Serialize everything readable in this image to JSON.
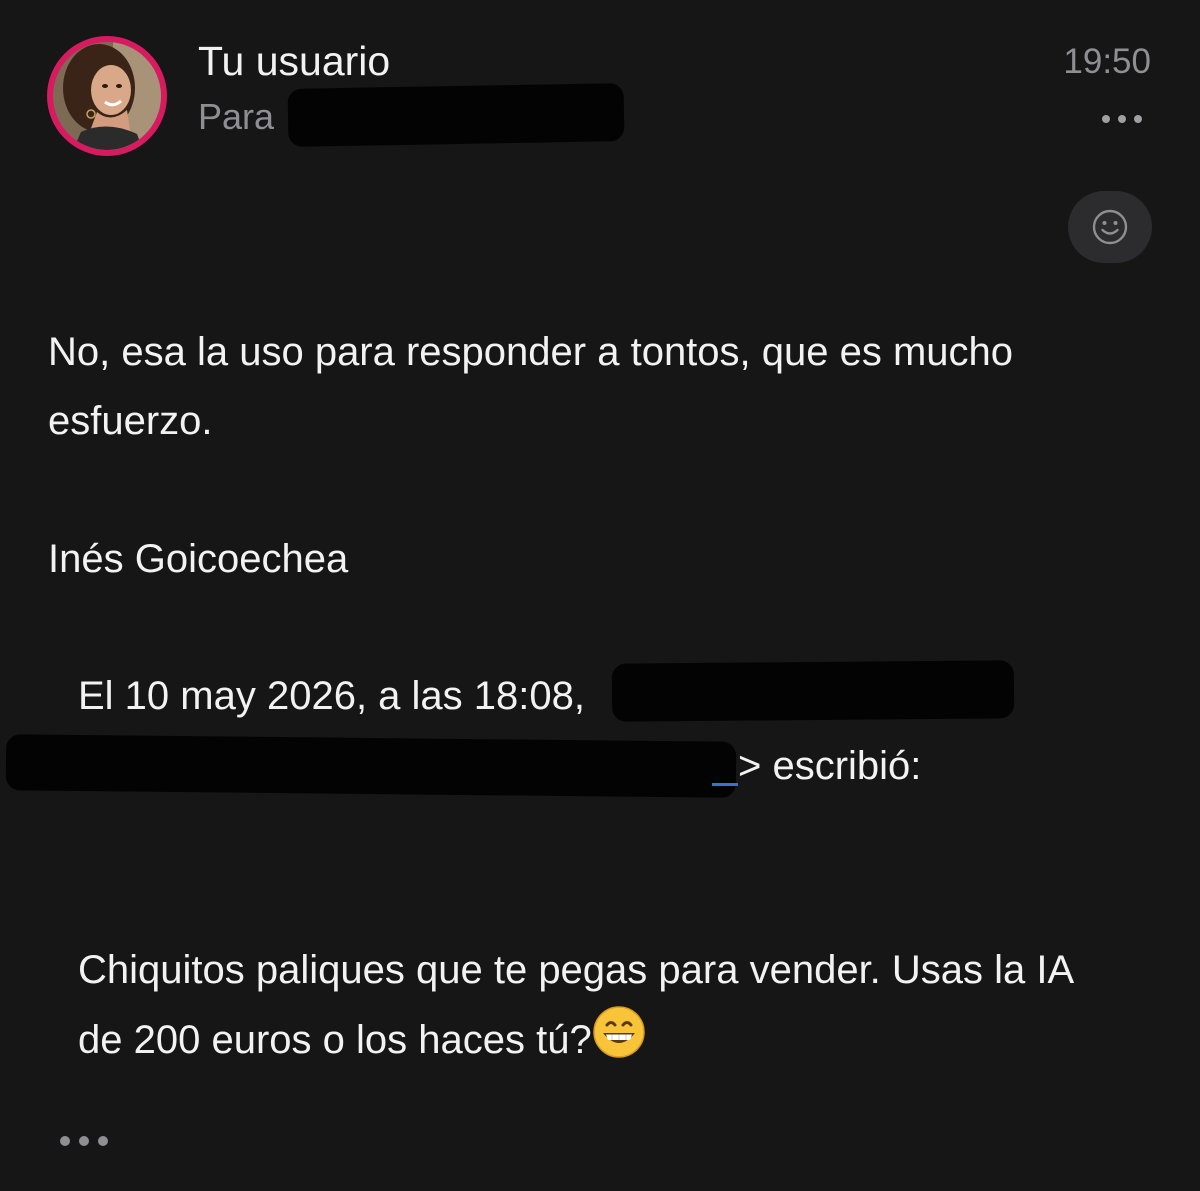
{
  "header": {
    "sender_name": "Tu usuario",
    "recipient_prefix": "Para",
    "time": "19:50"
  },
  "icons": {
    "avatar": "avatar-photo",
    "more_top": "more-horizontal-icon",
    "reaction": "smiley-icon",
    "more_bottom": "more-horizontal-icon",
    "emoji": "grinning-face-emoji"
  },
  "message": {
    "body": "No, esa la uso para responder a tontos, que es mucho esfuerzo.",
    "signature": "Inés Goicoechea",
    "quote_header_line1": "El 10 may 2026, a las 18:08,",
    "quote_header_line2_suffix": "> escribió:",
    "quoted_body": "Chiquitos paliques que te pegas para vender. Usas la IA de 200 euros o los haces tú?"
  },
  "colors": {
    "background": "#161617",
    "text": "#f2f2f2",
    "secondary": "#8e8e93",
    "avatar_ring": "#d81b60",
    "link": "#3a6fd8"
  }
}
